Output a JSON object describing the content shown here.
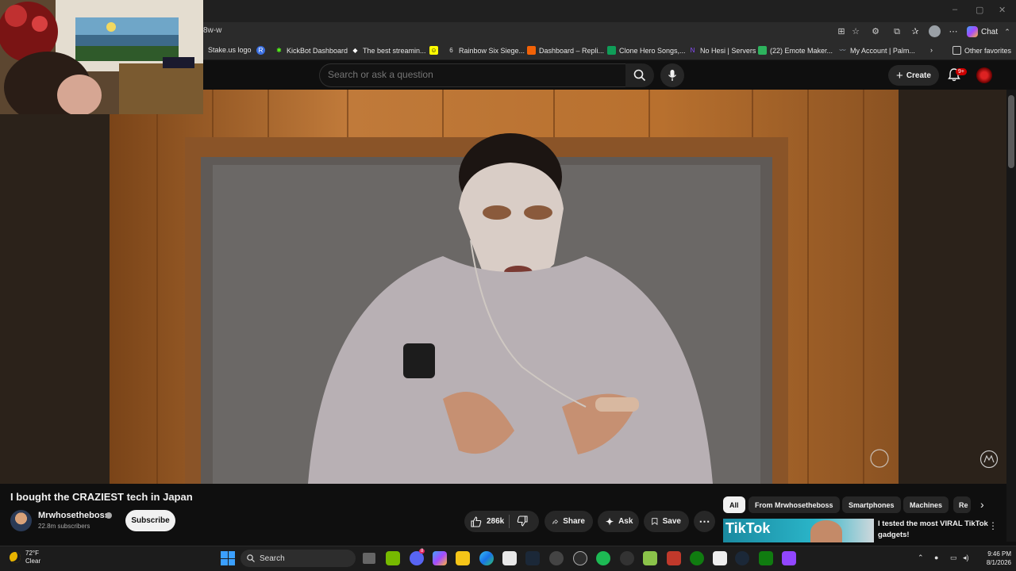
{
  "browser": {
    "url": "8w-w",
    "window_controls": {
      "minimize": "–",
      "maximize": "▢",
      "close": "✕"
    },
    "copilot_label": "Chat",
    "favorites": [
      {
        "label": "Stake.us logo",
        "icon": "stake-icon",
        "color": "#2b2b2b"
      },
      {
        "label": "",
        "icon": "r-icon",
        "color": "#3b6fe0"
      },
      {
        "label": "KickBot Dashboard",
        "icon": "kickbot-icon",
        "color": "#53fc18"
      },
      {
        "label": "The best streamin...",
        "icon": "diamond-icon",
        "color": "#ffffff"
      },
      {
        "label": "",
        "icon": "snapchat-icon",
        "color": "#fffc00"
      },
      {
        "label": "Rainbow Six Siege...",
        "icon": "r6-icon",
        "color": "#444444"
      },
      {
        "label": "Dashboard – Repli...",
        "icon": "replit-icon",
        "color": "#f26207"
      },
      {
        "label": "Clone Hero Songs,...",
        "icon": "sheets-icon",
        "color": "#0f9d58"
      },
      {
        "label": "No Hesi | Servers",
        "icon": "nohesi-icon",
        "color": "#6a2cff"
      },
      {
        "label": "(22) Emote Maker...",
        "icon": "emote-icon",
        "color": "#2db35d"
      },
      {
        "label": "My Account | Palm...",
        "icon": "palm-icon",
        "color": "#7a8aa0"
      }
    ],
    "favorites_more": "Other favorites"
  },
  "youtube": {
    "search_placeholder": "Search or ask a question",
    "create_label": "Create",
    "notifications_badge": "9+"
  },
  "video": {
    "title": "I bought the CRAZIEST tech in Japan",
    "channel_name": "Mrwhosetheboss",
    "subscribers": "22.8m subscribers",
    "subscribe_label": "Subscribe",
    "likes": "286k",
    "share_label": "Share",
    "ask_label": "Ask",
    "save_label": "Save"
  },
  "chips": [
    "All",
    "From Mrwhosetheboss",
    "Smartphones",
    "Machines",
    "Re"
  ],
  "recommendation": {
    "thumb_text": "TikTok",
    "title": "I tested the most VIRAL TikTok gadgets!"
  },
  "taskbar": {
    "temperature": "72°F",
    "condition": "Clear",
    "search_label": "Search",
    "time": "9:46 PM",
    "date": "8/1/2026",
    "discord_badge": "8"
  }
}
